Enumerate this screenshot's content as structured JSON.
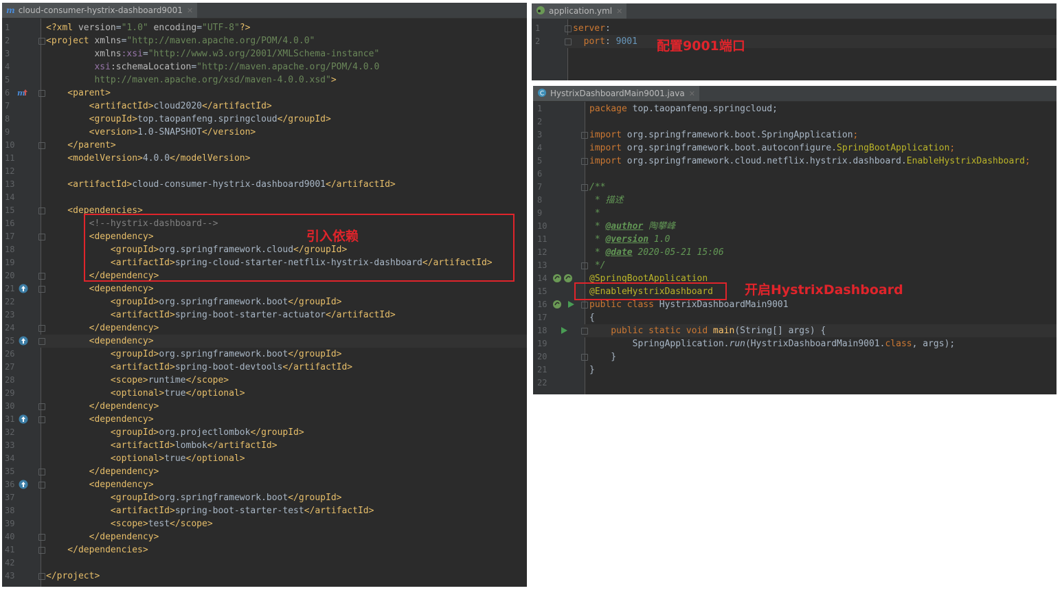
{
  "pom": {
    "tab_label": "cloud-consumer-hystrix-dashboard9001",
    "line_numbers": [
      "1",
      "2",
      "3",
      "4",
      "5",
      "6",
      "7",
      "8",
      "9",
      "10",
      "11",
      "12",
      "13",
      "14",
      "15",
      "16",
      "17",
      "18",
      "19",
      "20",
      "21",
      "22",
      "23",
      "24",
      "25",
      "26",
      "27",
      "28",
      "29",
      "30",
      "31",
      "32",
      "33",
      "34",
      "35",
      "36",
      "37",
      "38",
      "39",
      "40",
      "41",
      "42",
      "43"
    ],
    "lines": [
      [
        [
          "t",
          "<?xml "
        ],
        [
          "a",
          "version"
        ],
        [
          "",
          "="
        ],
        [
          "s",
          "\"1.0\""
        ],
        [
          "a",
          " encoding"
        ],
        [
          "",
          "="
        ],
        [
          "s",
          "\"UTF-8\""
        ],
        [
          "t",
          "?>"
        ]
      ],
      [
        [
          "t",
          "<project "
        ],
        [
          "a",
          "xmlns"
        ],
        [
          "",
          "="
        ],
        [
          "s",
          "\"http://maven.apache.org/POM/4.0.0\""
        ]
      ],
      [
        [
          "",
          "         "
        ],
        [
          "a",
          "xmlns"
        ],
        [
          "ns",
          ":xsi"
        ],
        [
          "",
          "="
        ],
        [
          "s",
          "\"http://www.w3.org/2001/XMLSchema-instance\""
        ]
      ],
      [
        [
          "",
          "         "
        ],
        [
          "ns",
          "xsi"
        ],
        [
          "a",
          ":schemaLocation"
        ],
        [
          "",
          "="
        ],
        [
          "s",
          "\"http://maven.apache.org/POM/4.0.0"
        ]
      ],
      [
        [
          "s",
          "         http://maven.apache.org/xsd/maven-4.0.0.xsd\""
        ],
        [
          "t",
          ">"
        ]
      ],
      [
        [
          "t",
          "    <parent>"
        ]
      ],
      [
        [
          "t",
          "        <artifactId>"
        ],
        [
          "",
          "cloud2020"
        ],
        [
          "t",
          "</artifactId>"
        ]
      ],
      [
        [
          "t",
          "        <groupId>"
        ],
        [
          "",
          "top.taopanfeng.springcloud"
        ],
        [
          "t",
          "</groupId>"
        ]
      ],
      [
        [
          "t",
          "        <version>"
        ],
        [
          "",
          "1.0-SNAPSHOT"
        ],
        [
          "t",
          "</version>"
        ]
      ],
      [
        [
          "t",
          "    </parent>"
        ]
      ],
      [
        [
          "t",
          "    <modelVersion>"
        ],
        [
          "",
          "4.0.0"
        ],
        [
          "t",
          "</modelVersion>"
        ]
      ],
      [],
      [
        [
          "t",
          "    <artifactId>"
        ],
        [
          "",
          "cloud-consumer-hystrix-dashboard9001"
        ],
        [
          "t",
          "</artifactId>"
        ]
      ],
      [],
      [
        [
          "t",
          "    <dependencies>"
        ]
      ],
      [
        [
          "cm",
          "        <!--hystrix-dashboard-->"
        ]
      ],
      [
        [
          "t",
          "        <dependency>"
        ]
      ],
      [
        [
          "t",
          "            <groupId>"
        ],
        [
          "",
          "org.springframework.cloud"
        ],
        [
          "t",
          "</groupId>"
        ]
      ],
      [
        [
          "t",
          "            <artifactId>"
        ],
        [
          "",
          "spring-cloud-starter-netflix-hystrix-dashboard"
        ],
        [
          "t",
          "</artifactId>"
        ]
      ],
      [
        [
          "t",
          "        </dependency>"
        ]
      ],
      [
        [
          "t",
          "        <dependency>"
        ]
      ],
      [
        [
          "t",
          "            <groupId>"
        ],
        [
          "",
          "org.springframework.boot"
        ],
        [
          "t",
          "</groupId>"
        ]
      ],
      [
        [
          "t",
          "            <artifactId>"
        ],
        [
          "",
          "spring-boot-starter-actuator"
        ],
        [
          "t",
          "</artifactId>"
        ]
      ],
      [
        [
          "t",
          "        </dependency>"
        ]
      ],
      [
        [
          "t",
          "        <dependency>"
        ]
      ],
      [
        [
          "t",
          "            <groupId>"
        ],
        [
          "",
          "org.springframework.boot"
        ],
        [
          "t",
          "</groupId>"
        ]
      ],
      [
        [
          "t",
          "            <artifactId>"
        ],
        [
          "",
          "spring-boot-devtools"
        ],
        [
          "t",
          "</artifactId>"
        ]
      ],
      [
        [
          "t",
          "            <scope>"
        ],
        [
          "",
          "runtime"
        ],
        [
          "t",
          "</scope>"
        ]
      ],
      [
        [
          "t",
          "            <optional>"
        ],
        [
          "",
          "true"
        ],
        [
          "t",
          "</optional>"
        ]
      ],
      [
        [
          "t",
          "        </dependency>"
        ]
      ],
      [
        [
          "t",
          "        <dependency>"
        ]
      ],
      [
        [
          "t",
          "            <groupId>"
        ],
        [
          "",
          "org.projectlombok"
        ],
        [
          "t",
          "</groupId>"
        ]
      ],
      [
        [
          "t",
          "            <artifactId>"
        ],
        [
          "",
          "lombok"
        ],
        [
          "t",
          "</artifactId>"
        ]
      ],
      [
        [
          "t",
          "            <optional>"
        ],
        [
          "",
          "true"
        ],
        [
          "t",
          "</optional>"
        ]
      ],
      [
        [
          "t",
          "        </dependency>"
        ]
      ],
      [
        [
          "t",
          "        <dependency>"
        ]
      ],
      [
        [
          "t",
          "            <groupId>"
        ],
        [
          "",
          "org.springframework.boot"
        ],
        [
          "t",
          "</groupId>"
        ]
      ],
      [
        [
          "t",
          "            <artifactId>"
        ],
        [
          "",
          "spring-boot-starter-test"
        ],
        [
          "t",
          "</artifactId>"
        ]
      ],
      [
        [
          "t",
          "            <scope>"
        ],
        [
          "",
          "test"
        ],
        [
          "t",
          "</scope>"
        ]
      ],
      [
        [
          "t",
          "        </dependency>"
        ]
      ],
      [
        [
          "t",
          "    </dependencies>"
        ]
      ],
      [],
      [
        [
          "t",
          "</project>"
        ]
      ]
    ],
    "annotation": "引入依赖"
  },
  "yml": {
    "tab_label": "application.yml",
    "line_numbers": [
      "1",
      "2"
    ],
    "lines": [
      [
        [
          "yk",
          "server"
        ],
        [
          "",
          ":"
        ]
      ],
      [
        [
          "yk",
          "  port"
        ],
        [
          "",
          ": "
        ],
        [
          "num",
          "9001"
        ]
      ]
    ],
    "annotation": "配置9001端口"
  },
  "java": {
    "tab_label": "HystrixDashboardMain9001.java",
    "line_numbers": [
      "1",
      "2",
      "3",
      "4",
      "5",
      "6",
      "7",
      "8",
      "9",
      "10",
      "11",
      "12",
      "13",
      "14",
      "15",
      "16",
      "17",
      "18",
      "19",
      "20",
      "21",
      "22"
    ],
    "lines": [
      [
        [
          "k",
          "package "
        ],
        [
          "",
          "top.taopanfeng.springcloud;"
        ]
      ],
      [],
      [
        [
          "k",
          "import "
        ],
        [
          "",
          "org.springframework.boot.SpringApplication"
        ],
        [
          "k",
          ";"
        ]
      ],
      [
        [
          "k",
          "import "
        ],
        [
          "",
          "org.springframework.boot.autoconfigure."
        ],
        [
          "an",
          "SpringBootApplication"
        ],
        [
          "k",
          ";"
        ]
      ],
      [
        [
          "k",
          "import "
        ],
        [
          "",
          "org.springframework.cloud.netflix.hystrix.dashboard."
        ],
        [
          "an",
          "EnableHystrixDashboard"
        ],
        [
          "k",
          ";"
        ]
      ],
      [],
      [
        [
          "doc",
          "/**"
        ]
      ],
      [
        [
          "doc",
          " * 描述"
        ]
      ],
      [
        [
          "doc",
          " *"
        ]
      ],
      [
        [
          "doc",
          " * "
        ],
        [
          "doctag",
          "@author"
        ],
        [
          "doc",
          " 陶攀峰"
        ]
      ],
      [
        [
          "doc",
          " * "
        ],
        [
          "doctag",
          "@version"
        ],
        [
          "doc",
          " 1.0"
        ]
      ],
      [
        [
          "doc",
          " * "
        ],
        [
          "doctag",
          "@date"
        ],
        [
          "doc",
          " 2020-05-21 15:06"
        ]
      ],
      [
        [
          "doc",
          " */"
        ]
      ],
      [
        [
          "an",
          "@SpringBootApplication"
        ]
      ],
      [
        [
          "an",
          "@EnableHystrixDashboard"
        ]
      ],
      [
        [
          "k",
          "public class "
        ],
        [
          "",
          "HystrixDashboardMain9001"
        ]
      ],
      [
        [
          "",
          "{"
        ]
      ],
      [
        [
          "k",
          "    public static void "
        ],
        [
          "m",
          "main"
        ],
        [
          "",
          "(String[] args) {"
        ]
      ],
      [
        [
          "",
          "        SpringApplication."
        ],
        [
          "it",
          "run"
        ],
        [
          "",
          "(HystrixDashboardMain9001."
        ],
        [
          "k",
          "class"
        ],
        [
          "",
          ", args);"
        ]
      ],
      [
        [
          "",
          "    }"
        ]
      ],
      [
        [
          "",
          "}"
        ]
      ],
      []
    ],
    "annotation": "开启HystrixDashboard"
  },
  "colors": {
    "annotation": "#e0242b",
    "editor_bg": "#2b2b2b"
  }
}
